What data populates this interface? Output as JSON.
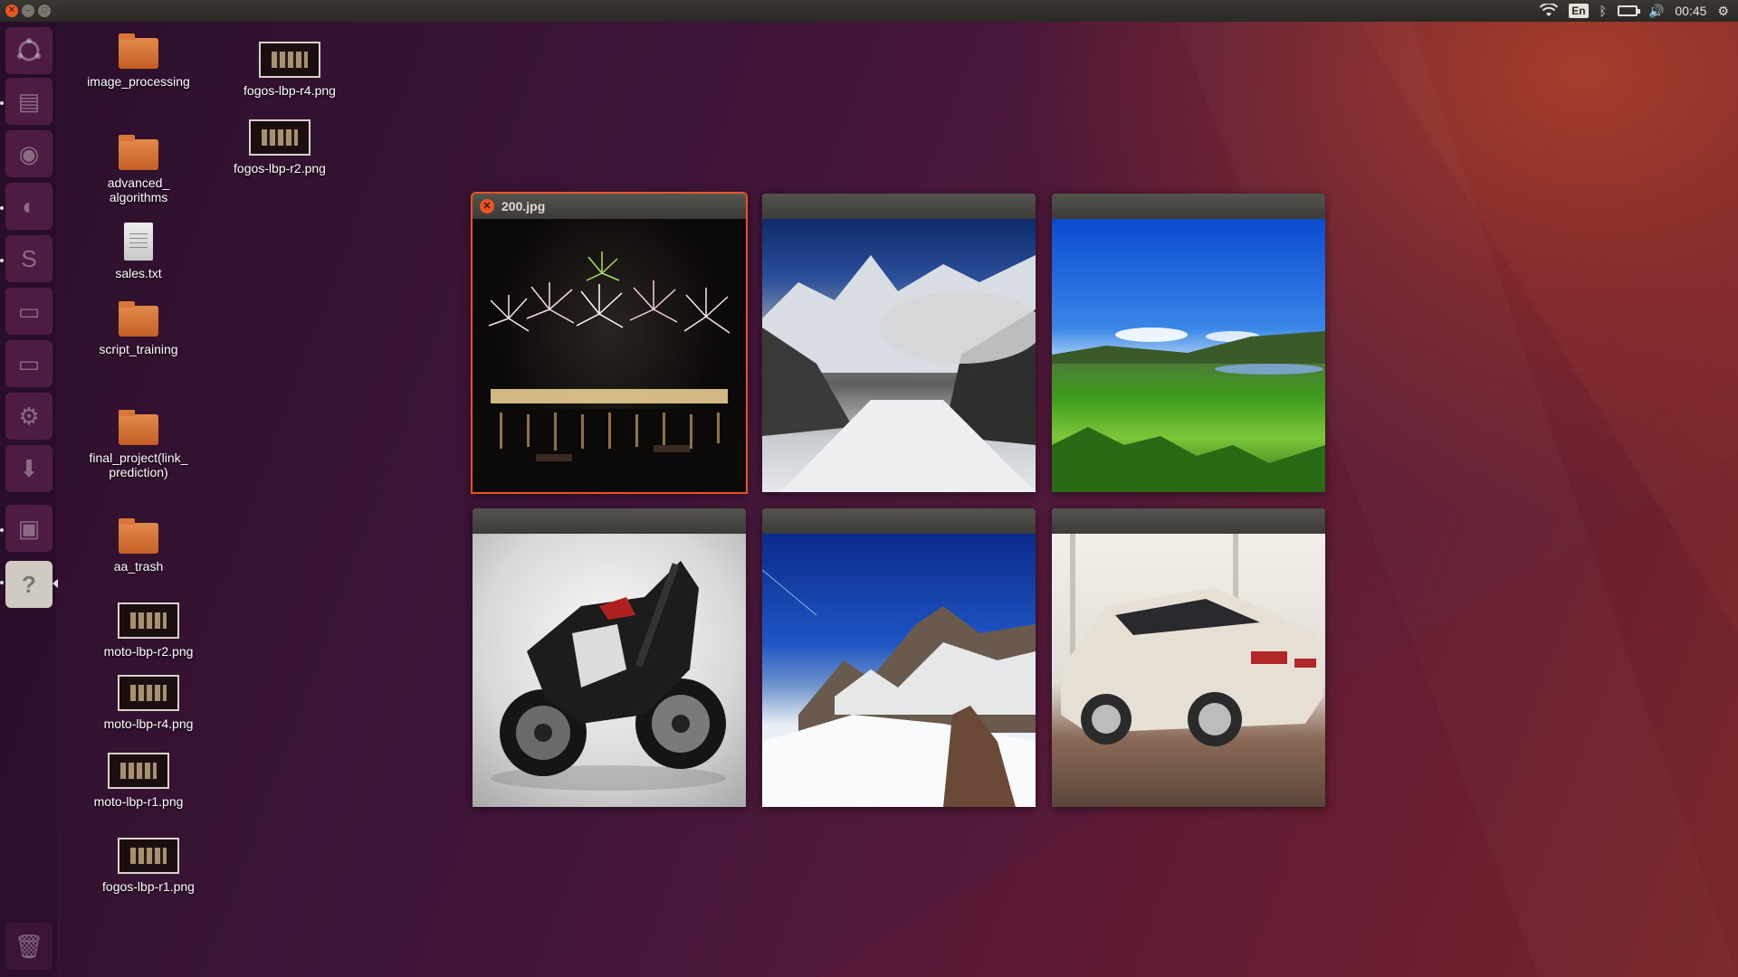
{
  "top_panel": {
    "window_buttons": [
      "close",
      "minimize",
      "maximize"
    ],
    "indicators": {
      "wifi_icon": "wifi-icon",
      "keyboard_layout": "En",
      "bluetooth_icon": "bluetooth-icon",
      "battery_icon": "battery-icon",
      "volume_icon": "volume-icon",
      "clock": "00:45",
      "power_icon": "gear-icon"
    }
  },
  "launcher": {
    "items": [
      {
        "name": "dash-home",
        "icon": "ubuntu-logo-icon"
      },
      {
        "name": "files",
        "icon": "file-cabinet-icon"
      },
      {
        "name": "chrome",
        "icon": "browser-icon"
      },
      {
        "name": "firefox",
        "icon": "firefox-icon"
      },
      {
        "name": "sublime-text",
        "icon": "text-editor-icon"
      },
      {
        "name": "drive-1",
        "icon": "drive-icon"
      },
      {
        "name": "drive-2",
        "icon": "drive-icon"
      },
      {
        "name": "system-settings",
        "icon": "gear-icon"
      },
      {
        "name": "downloads",
        "icon": "download-icon"
      },
      {
        "name": "image-viewer",
        "icon": "image-viewer-icon"
      },
      {
        "name": "help",
        "icon": "help-icon",
        "glyph": "?"
      },
      {
        "name": "trash",
        "icon": "trash-icon"
      }
    ]
  },
  "desktop": {
    "icons": [
      {
        "label": "image_processing",
        "type": "folder"
      },
      {
        "label": "advanced_\nalgorithms",
        "type": "folder"
      },
      {
        "label": "sales.txt",
        "type": "text"
      },
      {
        "label": "script_training",
        "type": "folder"
      },
      {
        "label": "final_project(link_\nprediction)",
        "type": "folder"
      },
      {
        "label": "aa_trash",
        "type": "folder"
      },
      {
        "label": "moto-lbp-r2.png",
        "type": "image"
      },
      {
        "label": "moto-lbp-r4.png",
        "type": "image"
      },
      {
        "label": "moto-lbp-r1.png",
        "type": "image"
      },
      {
        "label": "fogos-lbp-r1.png",
        "type": "image"
      },
      {
        "label": "fogos-lbp-r4.png",
        "type": "image"
      },
      {
        "label": "fogos-lbp-r2.png",
        "type": "image"
      }
    ]
  },
  "spread": {
    "windows": [
      {
        "title": "200.jpg",
        "photo": "fireworks",
        "focused": true
      },
      {
        "title": "",
        "photo": "glacier",
        "focused": false
      },
      {
        "title": "",
        "photo": "green-field",
        "focused": false
      },
      {
        "title": "",
        "photo": "motorcycle",
        "focused": false
      },
      {
        "title": "",
        "photo": "snowy-mountain",
        "focused": false
      },
      {
        "title": "",
        "photo": "car",
        "focused": false
      }
    ]
  },
  "colors": {
    "accent": "#e95420",
    "panel": "#3c3b37"
  }
}
